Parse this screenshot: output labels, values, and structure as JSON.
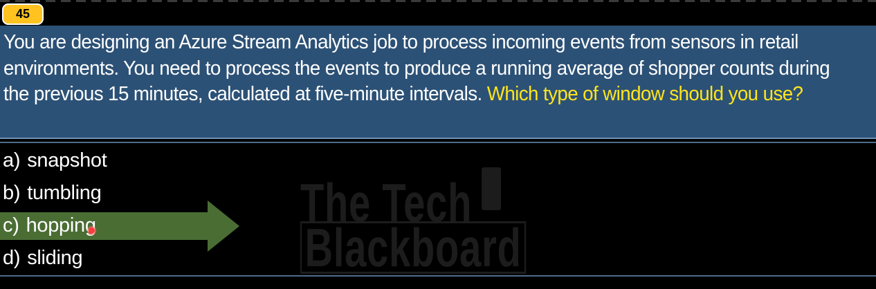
{
  "question": {
    "number": "45",
    "text_main": "You are designing an Azure Stream Analytics job to process incoming events from sensors in retail environments. You need to process the events to produce a running average of shopper counts during the previous 15 minutes, calculated at five-minute intervals.",
    "text_highlight": "Which type of window should you use?"
  },
  "options": [
    {
      "letter": "a)",
      "label": "snapshot"
    },
    {
      "letter": "b)",
      "label": "tumbling"
    },
    {
      "letter": "c)",
      "label": "hopping"
    },
    {
      "letter": "d)",
      "label": "sliding"
    }
  ],
  "selected_option": "c)",
  "watermark": {
    "line1": "The Tech",
    "line2": "Blackboard"
  },
  "colors": {
    "badge": "#ffc21f",
    "panel": "#2c5176",
    "highlight_text": "#ffe51c",
    "arrow": "#4a6d34",
    "background": "#000000"
  }
}
